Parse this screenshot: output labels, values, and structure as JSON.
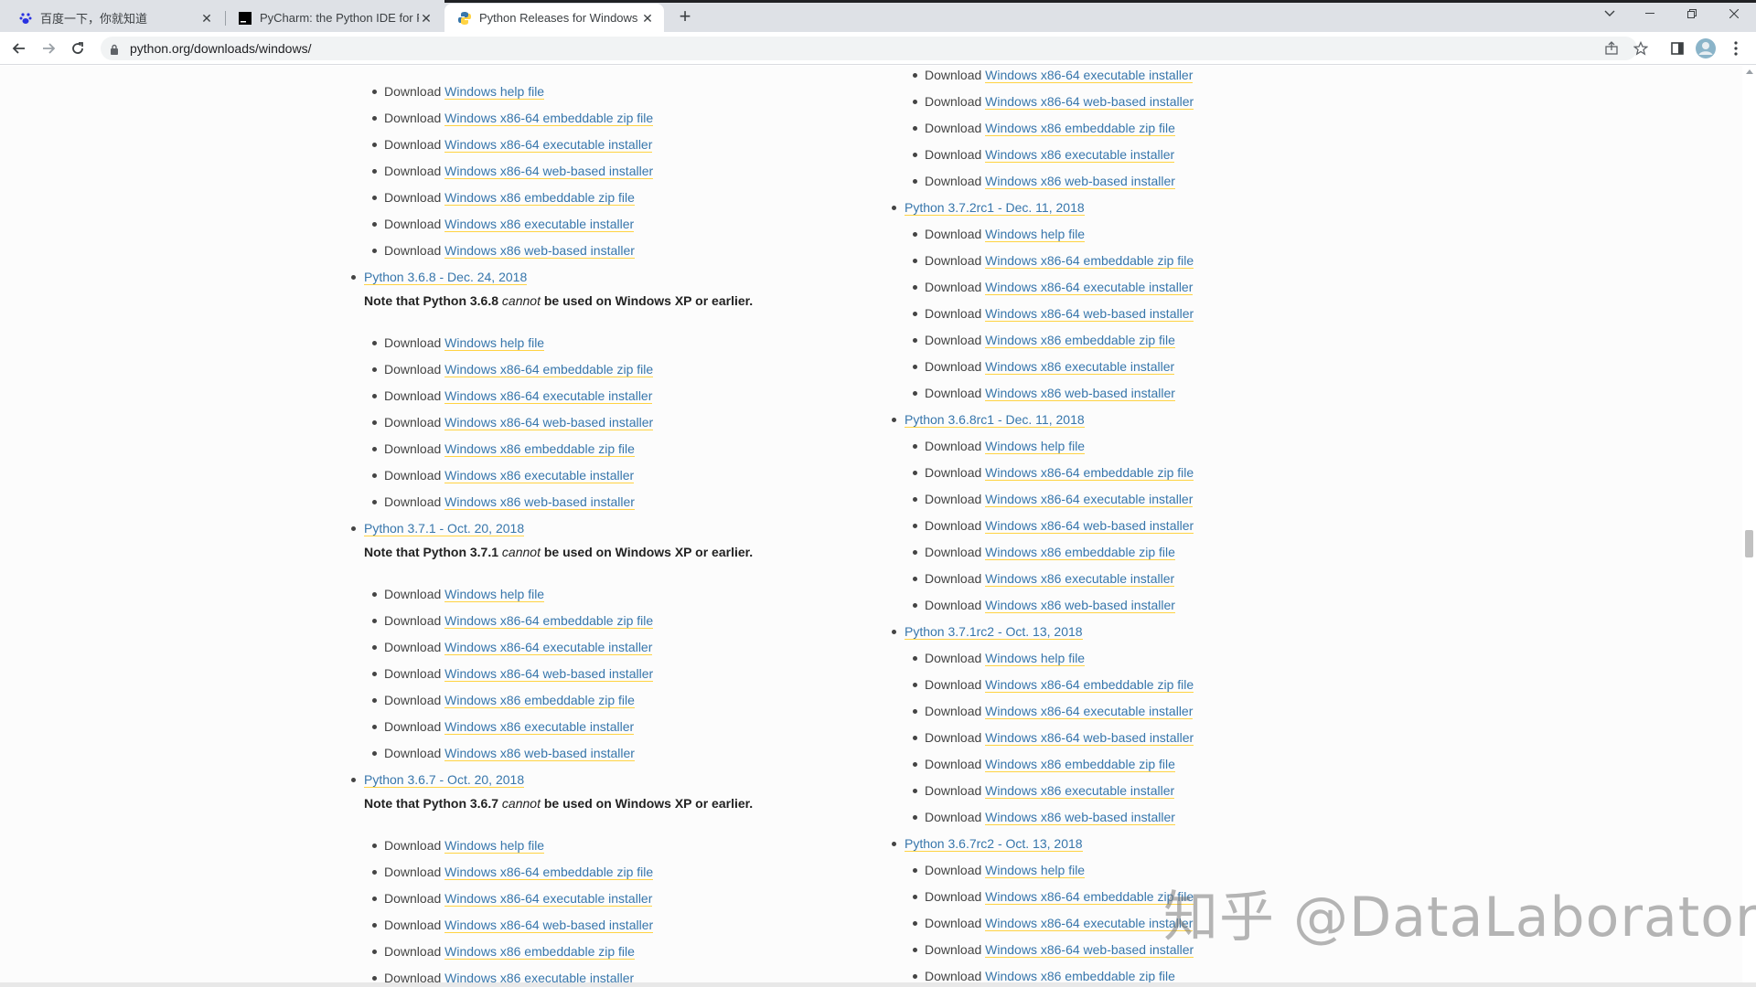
{
  "browser": {
    "tabs": [
      {
        "title": "百度一下，你就知道"
      },
      {
        "title": "PyCharm: the Python IDE for P"
      },
      {
        "title": "Python Releases for Windows"
      }
    ],
    "url": "python.org/downloads/windows/"
  },
  "left_column": [
    {
      "downloads": [
        "Windows help file",
        "Windows x86-64 embeddable zip file",
        "Windows x86-64 executable installer",
        "Windows x86-64 web-based installer",
        "Windows x86 embeddable zip file",
        "Windows x86 executable installer",
        "Windows x86 web-based installer"
      ]
    },
    {
      "title": "Python 3.6.8 - Dec. 24, 2018",
      "note_pre": "Note that Python 3.6.8 ",
      "note_em": "cannot",
      "note_post": " be used on Windows XP or earlier.",
      "downloads": [
        "Windows help file",
        "Windows x86-64 embeddable zip file",
        "Windows x86-64 executable installer",
        "Windows x86-64 web-based installer",
        "Windows x86 embeddable zip file",
        "Windows x86 executable installer",
        "Windows x86 web-based installer"
      ]
    },
    {
      "title": "Python 3.7.1 - Oct. 20, 2018",
      "note_pre": "Note that Python 3.7.1 ",
      "note_em": "cannot",
      "note_post": " be used on Windows XP or earlier.",
      "downloads": [
        "Windows help file",
        "Windows x86-64 embeddable zip file",
        "Windows x86-64 executable installer",
        "Windows x86-64 web-based installer",
        "Windows x86 embeddable zip file",
        "Windows x86 executable installer",
        "Windows x86 web-based installer"
      ]
    },
    {
      "title": "Python 3.6.7 - Oct. 20, 2018",
      "note_pre": "Note that Python 3.6.7 ",
      "note_em": "cannot",
      "note_post": " be used on Windows XP or earlier.",
      "downloads": [
        "Windows help file",
        "Windows x86-64 embeddable zip file",
        "Windows x86-64 executable installer",
        "Windows x86-64 web-based installer",
        "Windows x86 embeddable zip file",
        "Windows x86 executable installer"
      ]
    }
  ],
  "right_column": [
    {
      "downloads": [
        "Windows x86-64 executable installer",
        "Windows x86-64 web-based installer",
        "Windows x86 embeddable zip file",
        "Windows x86 executable installer",
        "Windows x86 web-based installer"
      ]
    },
    {
      "title": "Python 3.7.2rc1 - Dec. 11, 2018",
      "downloads": [
        "Windows help file",
        "Windows x86-64 embeddable zip file",
        "Windows x86-64 executable installer",
        "Windows x86-64 web-based installer",
        "Windows x86 embeddable zip file",
        "Windows x86 executable installer",
        "Windows x86 web-based installer"
      ]
    },
    {
      "title": "Python 3.6.8rc1 - Dec. 11, 2018",
      "downloads": [
        "Windows help file",
        "Windows x86-64 embeddable zip file",
        "Windows x86-64 executable installer",
        "Windows x86-64 web-based installer",
        "Windows x86 embeddable zip file",
        "Windows x86 executable installer",
        "Windows x86 web-based installer"
      ]
    },
    {
      "title": "Python 3.7.1rc2 - Oct. 13, 2018",
      "downloads": [
        "Windows help file",
        "Windows x86-64 embeddable zip file",
        "Windows x86-64 executable installer",
        "Windows x86-64 web-based installer",
        "Windows x86 embeddable zip file",
        "Windows x86 executable installer",
        "Windows x86 web-based installer"
      ]
    },
    {
      "title": "Python 3.6.7rc2 - Oct. 13, 2018",
      "downloads": [
        "Windows help file",
        "Windows x86-64 embeddable zip file",
        "Windows x86-64 executable installer",
        "Windows x86-64 web-based installer",
        "Windows x86 embeddable zip file"
      ]
    }
  ],
  "download_word": "Download",
  "watermark": "知乎 @DataLaboratory",
  "colors": {
    "link": "#3776ab",
    "underline": "#ffd343",
    "text": "#444444"
  }
}
